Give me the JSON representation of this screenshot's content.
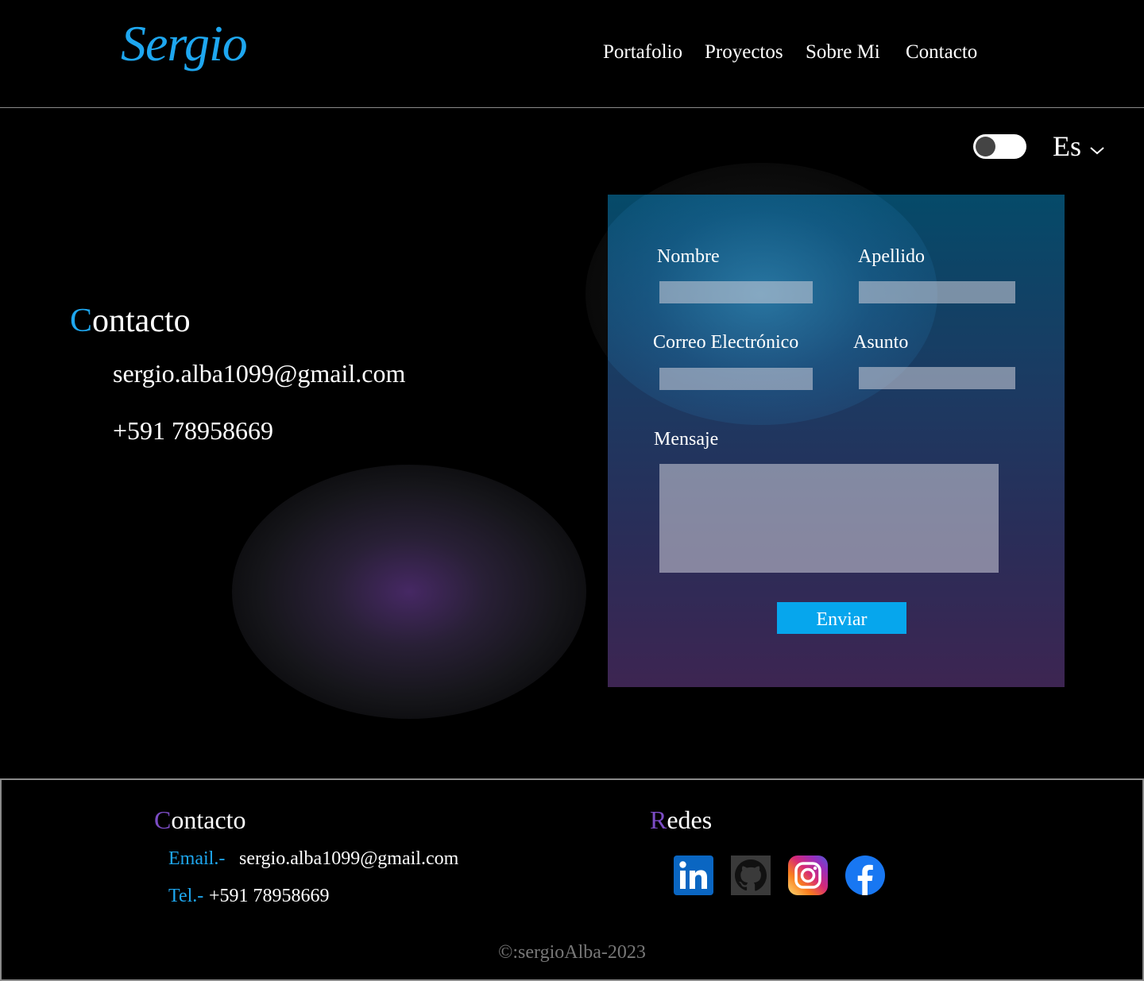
{
  "brand": {
    "logo_text": "Sergio"
  },
  "nav": {
    "items": [
      "Portafolio",
      "Proyectos",
      "Sobre Mi",
      "Contacto"
    ]
  },
  "settings": {
    "language": "Es",
    "theme_toggle": "off"
  },
  "contact": {
    "title_first": "C",
    "title_rest": "ontacto",
    "email": "sergio.alba1099@gmail.com",
    "phone": "+591 78958669"
  },
  "form": {
    "first_name_label": "Nombre",
    "last_name_label": "Apellido",
    "email_label": "Correo Electrónico",
    "subject_label": "Asunto",
    "message_label": "Mensaje",
    "submit_label": "Enviar"
  },
  "footer": {
    "contact_title_first": "C",
    "contact_title_rest": "ontacto",
    "email_label": "Email.-",
    "email_value": "sergio.alba1099@gmail.com",
    "tel_label": "Tel.-",
    "tel_value": "+591 78958669",
    "social_title_first": "R",
    "social_title_rest": "edes",
    "social_icons": [
      "linkedin-icon",
      "github-icon",
      "instagram-icon",
      "facebook-icon"
    ],
    "copyright": "©:sergioAlba-2023"
  },
  "colors": {
    "accent_blue": "#1ea7f0",
    "accent_purple": "#7b4cc4",
    "button": "#06a6ed"
  }
}
